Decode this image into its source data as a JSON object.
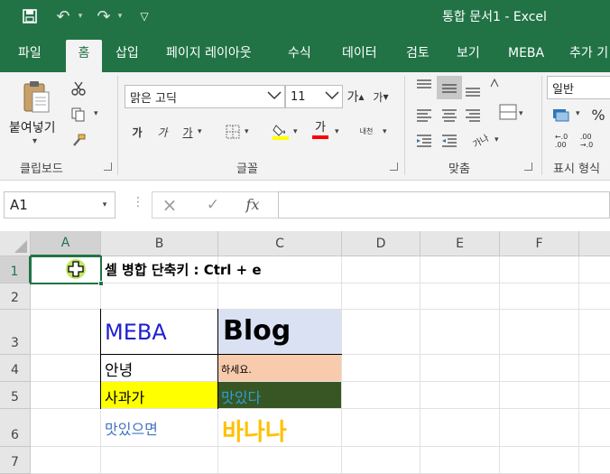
{
  "window": {
    "title": "통합 문서1  -  Excel",
    "undo_glyph": "↶",
    "redo_glyph": "↷",
    "customize_glyph": "▽"
  },
  "tabs": [
    "파일",
    "홈",
    "삽입",
    "페이지 레이아웃",
    "수식",
    "데이터",
    "검토",
    "보기",
    "MEBA",
    "추가 기"
  ],
  "ribbon": {
    "clipboard": {
      "paste_label": "붙여넣기",
      "paste_dropdown": "▾",
      "group_label": "클립보드"
    },
    "font": {
      "font_name": "맑은 고딕",
      "font_size": "11",
      "grow_glyph": "가",
      "shrink_glyph": "가",
      "bold": "가",
      "italic": "가",
      "underline": "가",
      "font_color_glyph": "가",
      "phonetic_glyph": "내천",
      "group_label": "글꼴"
    },
    "alignment": {
      "group_label": "맞춤",
      "orientation_glyph": "가나"
    },
    "number": {
      "format": "일반",
      "percent": "%",
      "inc_decimal": "←.0\n.00",
      "dec_decimal": ".00\n→.0",
      "group_label": "표시 형식"
    },
    "colors": {
      "accent": "#217346",
      "fill_yellow": "#ffff00",
      "font_red": "#ff0000"
    }
  },
  "formula_bar": {
    "name_box": "A1",
    "cancel": "×",
    "enter": "✓",
    "fx": "fx",
    "formula": ""
  },
  "grid": {
    "columns": [
      "A",
      "B",
      "C",
      "D",
      "E",
      "F"
    ],
    "rows": [
      "1",
      "2",
      "3",
      "4",
      "5",
      "6",
      "7"
    ],
    "cells": {
      "B1": "셀 병합 단축키 : Ctrl + e",
      "B3": "MEBA",
      "C3": "Blog",
      "B4": "안녕",
      "C4": "하세요.",
      "B5": "사과가",
      "C5": "맛있다",
      "B6": "맛있으면",
      "C6": "바나나"
    }
  },
  "colors": {
    "blue_text": "#1f1fd1",
    "c3_fill": "#d9e1f2",
    "c4_fill": "#f8cbad",
    "b5_fill": "#ffff00",
    "c5_fill": "#375623",
    "c5_text": "#2e9fd6",
    "b6_text": "#4472c4",
    "c6_text": "#ffc000"
  }
}
